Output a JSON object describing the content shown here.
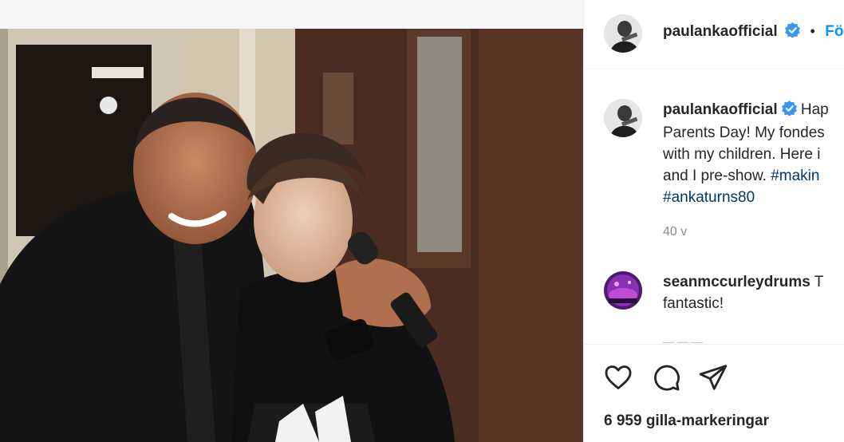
{
  "post_header": {
    "username": "paulankaofficial",
    "separator": "•",
    "follow_label": "Fö"
  },
  "caption": {
    "username": "paulankaofficial",
    "line1": "Hap",
    "line2": "Parents Day! My fondes",
    "line3": "with my children. Here i",
    "line4_text": "and I pre-show. ",
    "line4_tag": "#makin",
    "line5_tag": "#ankaturns80",
    "time": "40 v"
  },
  "comment1": {
    "username": "seanmccurleydrums",
    "text_start": "T",
    "text_line2": "fantastic!"
  },
  "actions": {
    "like_icon": "heart-icon",
    "comment_icon": "comment-icon",
    "share_icon": "paper-plane-icon"
  },
  "likes_text": "6 959 gilla-markeringar",
  "colors": {
    "accent": "#0095f6",
    "verified": "#3897f0",
    "hashtag": "#00376b",
    "muted": "#8e8e8e"
  }
}
